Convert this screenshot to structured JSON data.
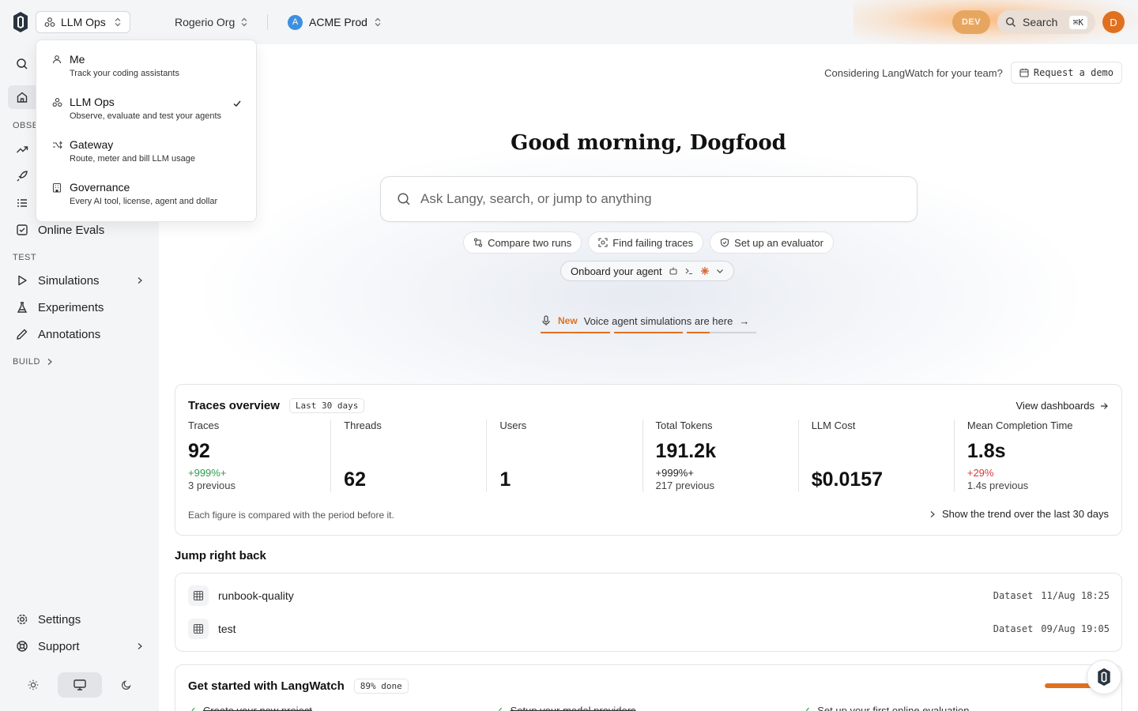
{
  "topbar": {
    "product": "LLM Ops",
    "org": "Rogerio Org",
    "project": "ACME Prod",
    "project_initial": "A",
    "env_badge": "DEV",
    "search": "Search",
    "search_kbd": "⌘K",
    "user_initial": "D"
  },
  "product_menu": {
    "items": [
      {
        "title": "Me",
        "desc": "Track your coding assistants",
        "icon": "user-icon"
      },
      {
        "title": "LLM Ops",
        "desc": "Observe, evaluate and test your agents",
        "icon": "nodes-icon",
        "selected": true
      },
      {
        "title": "Gateway",
        "desc": "Route, meter and bill LLM usage",
        "icon": "gateway-icon"
      },
      {
        "title": "Governance",
        "desc": "Every AI tool, license, agent and dollar",
        "icon": "building-icon"
      }
    ]
  },
  "sidebar": {
    "section_observe": "OBSE",
    "online_evals": "Online Evals",
    "section_test": "TEST",
    "simulations": "Simulations",
    "experiments": "Experiments",
    "annotations": "Annotations",
    "section_build": "BUILD",
    "settings": "Settings",
    "support": "Support"
  },
  "main": {
    "demo_prompt": "Considering LangWatch for your team?",
    "demo_button": "Request a demo",
    "greeting": "Good morning, Dogfood",
    "ask_placeholder": "Ask Langy, search, or jump to anything",
    "chips": [
      "Compare two runs",
      "Find failing traces",
      "Set up an evaluator"
    ],
    "onboard": "Onboard your agent",
    "news_tag": "New",
    "news_text": "Voice agent simulations are here",
    "news_arrow": "→",
    "news_progress": [
      1.0,
      1.0,
      0.33
    ]
  },
  "traces": {
    "title": "Traces overview",
    "period": "Last 30 days",
    "view_link": "View dashboards",
    "metrics": [
      {
        "label": "Traces",
        "value": "92",
        "delta": "+999%+",
        "delta_color": "green",
        "prev": "3 previous"
      },
      {
        "label": "Threads",
        "value": "62",
        "delta": "",
        "prev": ""
      },
      {
        "label": "Users",
        "value": "1",
        "delta": "",
        "prev": ""
      },
      {
        "label": "Total Tokens",
        "value": "191.2k",
        "delta": "+999%+",
        "delta_color": "dark",
        "prev": "217 previous"
      },
      {
        "label": "LLM Cost",
        "value": "$0.0157",
        "delta": "",
        "prev": ""
      },
      {
        "label": "Mean Completion Time",
        "value": "1.8s",
        "delta": "+29%",
        "delta_color": "red",
        "prev": "1.4s previous"
      }
    ],
    "footnote": "Each figure is compared with the period before it.",
    "trend_link": "Show the trend over the last 30 days"
  },
  "jump": {
    "title": "Jump right back",
    "rows": [
      {
        "name": "runbook-quality",
        "type": "Dataset",
        "time": "11/Aug 18:25"
      },
      {
        "name": "test",
        "type": "Dataset",
        "time": "09/Aug 19:05"
      }
    ]
  },
  "get_started": {
    "title": "Get started with LangWatch",
    "progress_label": "89% done",
    "progress": 0.89,
    "steps": [
      "Create your new project",
      "Setup your model providers",
      "Set up your first online evaluation"
    ]
  },
  "colors": {
    "accent": "#e0701f",
    "green": "#2d9a4e",
    "red": "#d43a3a"
  }
}
